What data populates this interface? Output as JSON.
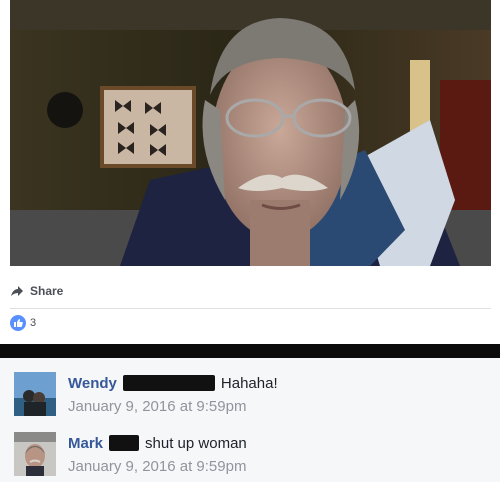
{
  "post": {
    "photo_description_icon": "webcam-photo",
    "share_label": "Share",
    "likes_count": "3"
  },
  "comments": [
    {
      "author": "Wendy",
      "text": "Hahaha!",
      "timestamp": "January 9, 2016 at 9:59pm"
    },
    {
      "author": "Mark",
      "text": "shut up woman",
      "timestamp": "January 9, 2016 at 9:59pm"
    }
  ],
  "colors": {
    "link": "#365899",
    "like": "#5890ff",
    "muted": "#90949c"
  }
}
